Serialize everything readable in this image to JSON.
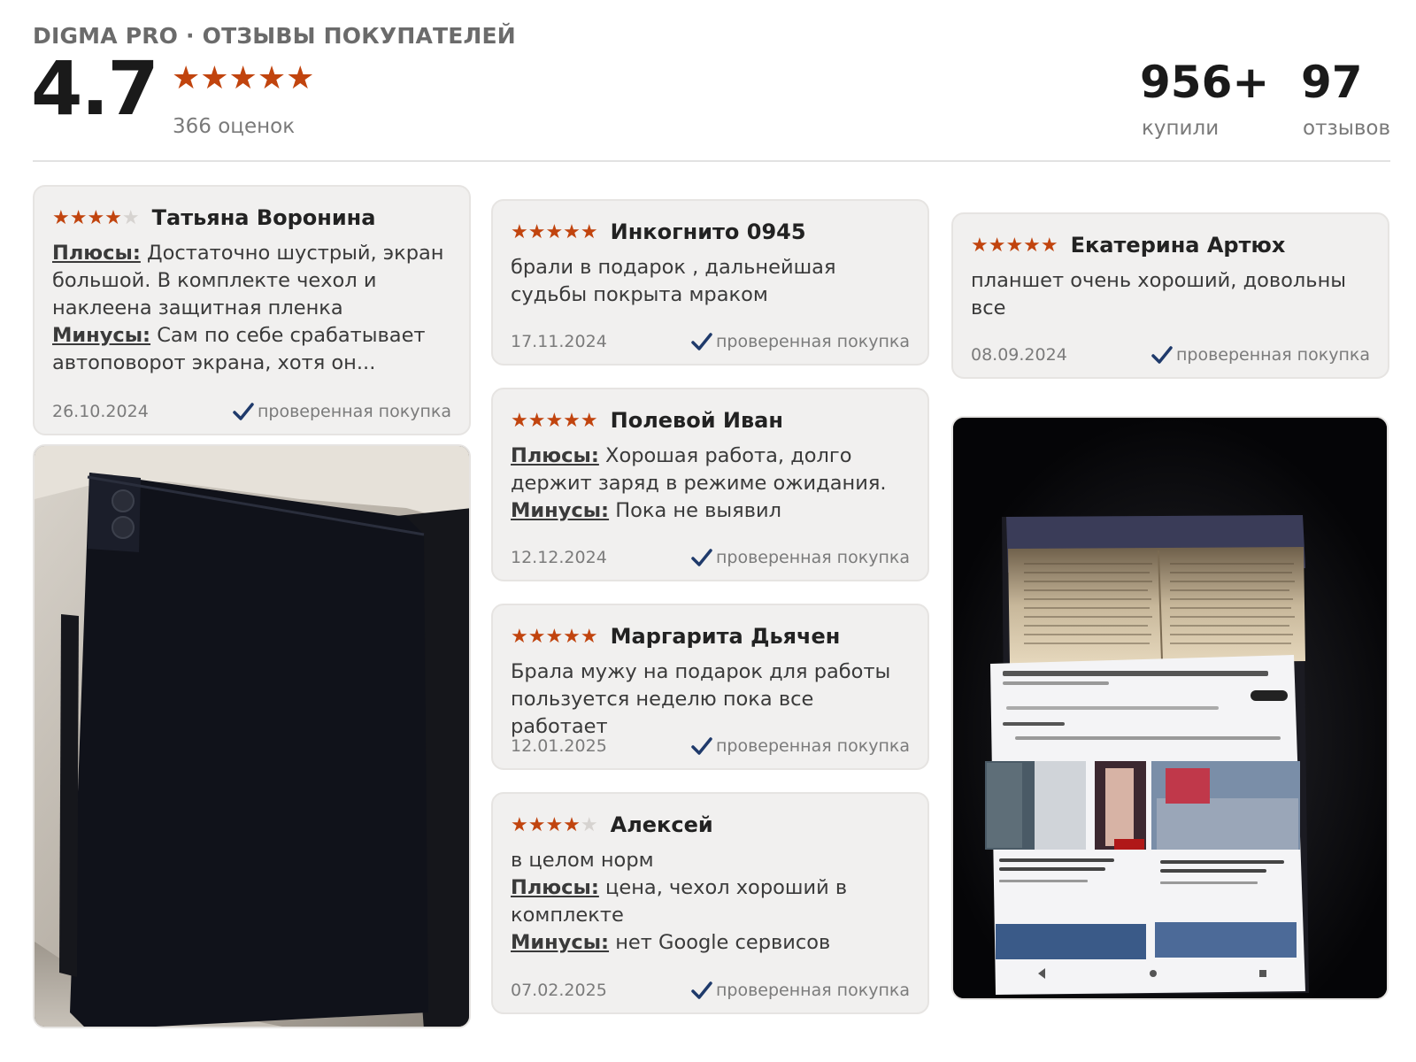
{
  "header": {
    "title": "DIGMA PRO · ОТЗЫВЫ ПОКУПАТЕЛЕЙ",
    "rating": "4.7",
    "stars": "★★★★★",
    "ratings_count": "366 оценок",
    "stats": [
      {
        "value": "956+",
        "label": "купили"
      },
      {
        "value": "97",
        "label": "отзывов"
      }
    ]
  },
  "colors": {
    "accent_star": "#c1440e",
    "verified_check": "#1f3a6b"
  },
  "verified_label": "проверенная покупка",
  "reviews": [
    {
      "stars": 4,
      "author": "Татьяна Воронина",
      "pros_label": "Плюсы:",
      "pros": "Достаточно шустрый, экран большой. В комплекте чехол и наклеена защитная пленка",
      "cons_label": "Минусы:",
      "cons": "Сам по себе срабатывает автоповорот экрана, хотя он...",
      "date": "26.10.2024"
    },
    {
      "stars": 5,
      "author": "Инкогнито 0945",
      "text": "брали в подарок , дальнейшая судьбы покрыта мраком",
      "date": "17.11.2024"
    },
    {
      "stars": 5,
      "author": "Екатерина Артюх",
      "text": "планшет очень хороший, довольны все",
      "date": "08.09.2024"
    },
    {
      "stars": 5,
      "author": "Полевой Иван",
      "pros_label": "Плюсы:",
      "pros": "Хорошая работа, долго держит заряд в режиме ожидания.",
      "cons_label": "Минусы:",
      "cons": "Пока не выявил",
      "date": "12.12.2024"
    },
    {
      "stars": 5,
      "author": "Маргарита Дьячен",
      "text": "Брала мужу на подарок для работы пользуется неделю пока все работает",
      "date": "12.01.2025"
    },
    {
      "stars": 4,
      "author": "Алексей",
      "text": "в целом норм",
      "pros_label": "Плюсы:",
      "pros": "цена, чехол хороший в комплекте",
      "cons_label": "Минусы:",
      "cons": "нет Google сервисов",
      "date": "07.02.2025"
    }
  ]
}
